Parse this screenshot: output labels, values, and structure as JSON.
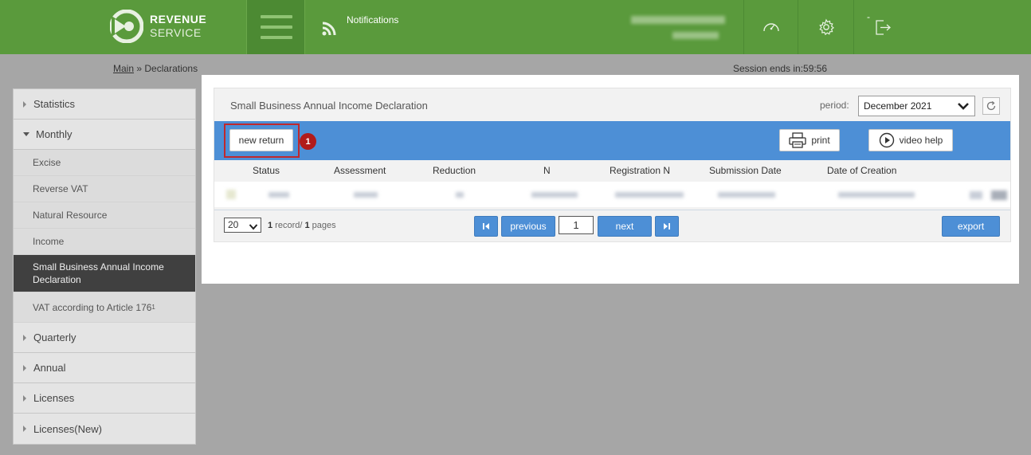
{
  "header": {
    "logo": {
      "line1": "REVENUE",
      "line2": "SERVICE"
    },
    "notifications_label": "Notifications",
    "logout_dash": "-"
  },
  "breadcrumb": {
    "root": "Main",
    "separator": "»",
    "current": "Declarations"
  },
  "session": {
    "text": "Session ends in:59:56"
  },
  "sidebar": {
    "groups": [
      {
        "label": "Statistics"
      },
      {
        "label": "Monthly"
      },
      {
        "label": "Quarterly"
      },
      {
        "label": "Annual"
      },
      {
        "label": "Licenses"
      },
      {
        "label": "Licenses(New)"
      }
    ],
    "monthly_items": [
      {
        "label": "Excise"
      },
      {
        "label": "Reverse VAT"
      },
      {
        "label": "Natural Resource"
      },
      {
        "label": "Income"
      },
      {
        "label": "Small Business Annual Income Declaration"
      },
      {
        "label": "VAT according to Article 176",
        "sup": "1"
      }
    ]
  },
  "declaration": {
    "title": "Small Business Annual Income Declaration",
    "period_label": "period:",
    "period_value": "December 2021",
    "toolbar": {
      "new_return": "new return",
      "badge": "1",
      "print": "print",
      "video_help": "video help"
    },
    "columns": [
      "Status",
      "Assessment",
      "Reduction",
      "N",
      "Registration N",
      "Submission Date",
      "Date of Creation"
    ],
    "pager": {
      "page_size": "20",
      "records_count": "1",
      "records_label": " record/ ",
      "pages_count": "1",
      "pages_label": " pages",
      "previous": "previous",
      "page": "1",
      "next": "next",
      "export": "export"
    }
  },
  "colors": {
    "header_green": "#5a9a3c",
    "toolbar_blue": "#4d8fd6",
    "highlight_red": "#c0282d",
    "active_sidebar": "#404040"
  }
}
